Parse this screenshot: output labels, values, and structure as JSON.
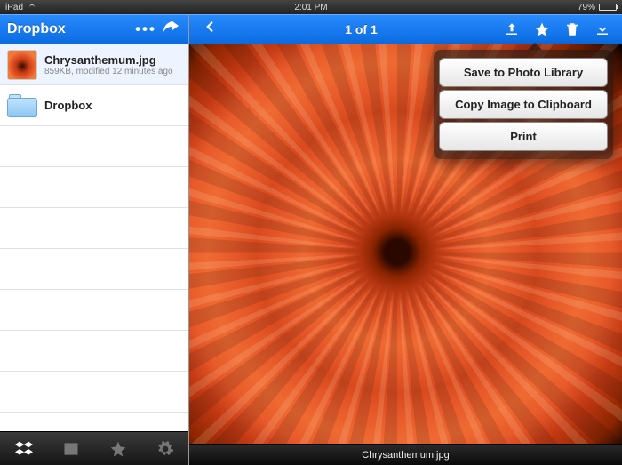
{
  "statusbar": {
    "device": "iPad",
    "time": "2:01 PM",
    "battery_pct": "79%"
  },
  "sidebar": {
    "title": "Dropbox",
    "items": [
      {
        "name": "Chrysanthemum.jpg",
        "sub": "859KB, modified 12 minutes ago",
        "type": "image"
      },
      {
        "name": "Dropbox",
        "sub": "",
        "type": "folder"
      }
    ]
  },
  "viewer": {
    "counter": "1 of 1",
    "filename": "Chrysanthemum.jpg"
  },
  "popover": {
    "save_photo": "Save to Photo Library",
    "copy_clip": "Copy Image to Clipboard",
    "print": "Print"
  }
}
